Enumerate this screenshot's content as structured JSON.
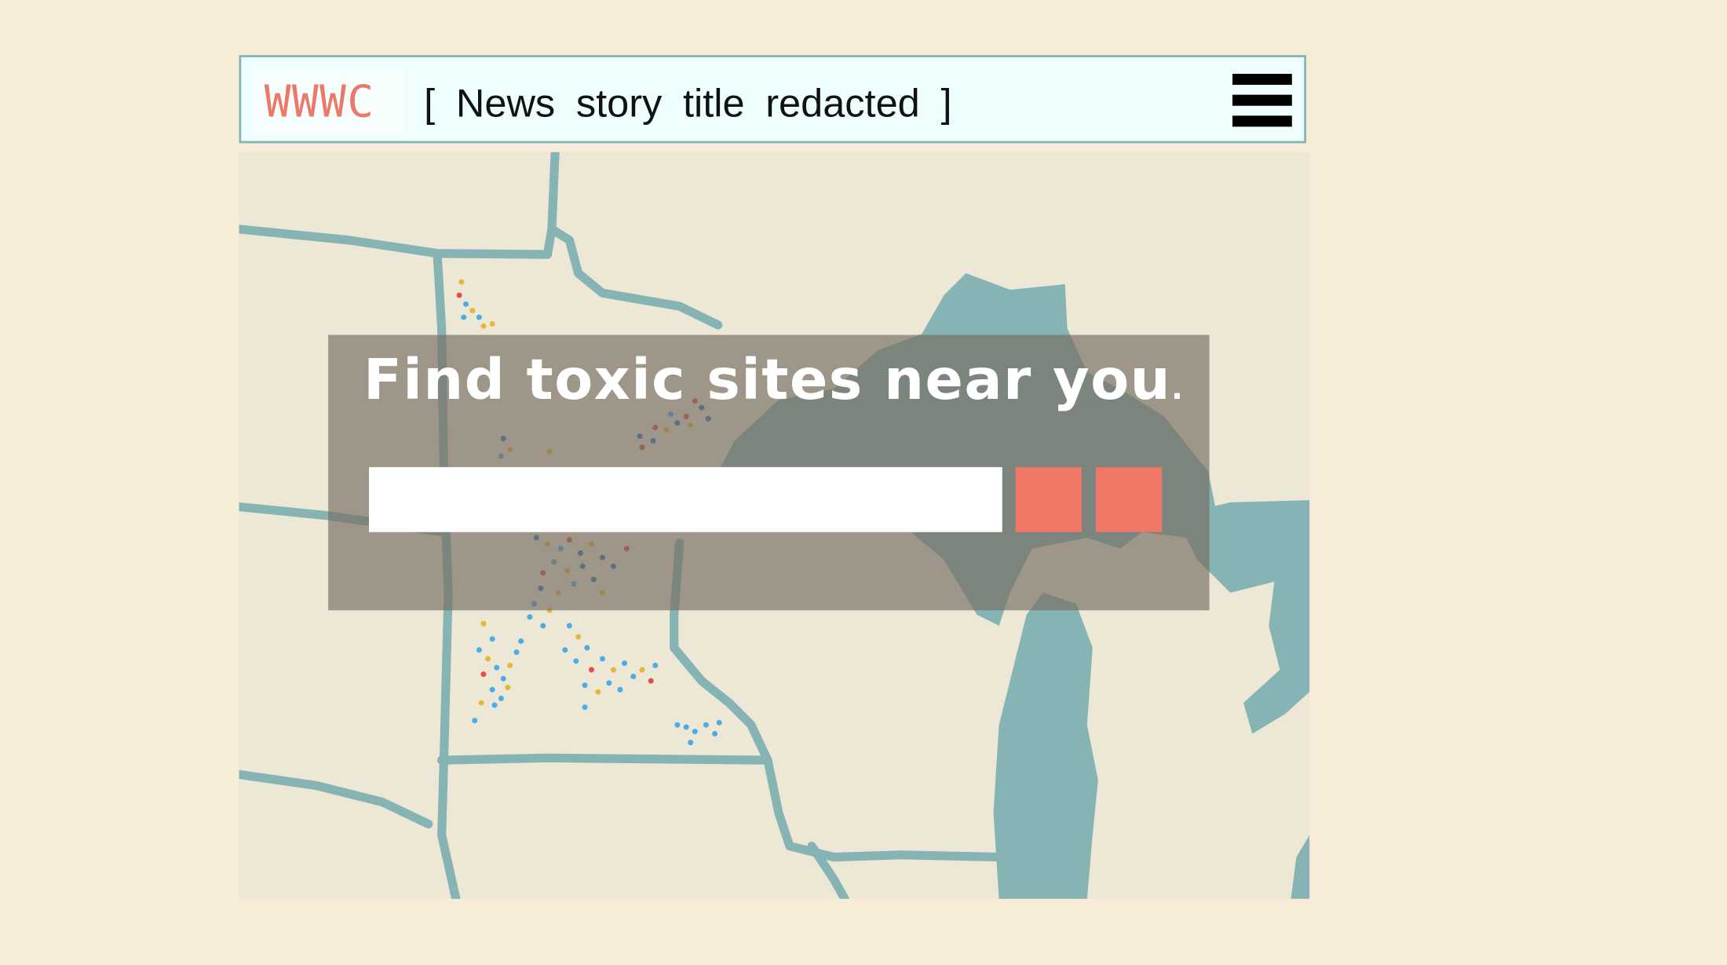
{
  "header": {
    "logo": "WWWC",
    "story_title": "[ News story title redacted ]"
  },
  "hero": {
    "headline": "Find toxic sites near you",
    "headline_punct": ".",
    "search_placeholder": "",
    "search_value": ""
  },
  "icons": {
    "menu": "hamburger-menu-icon"
  },
  "colors": {
    "page_background": "#f6ecd7",
    "header_background": "#eefefe",
    "logo_red": "#ec7868",
    "map_land": "#ede8d6",
    "map_water": "#86b4b4",
    "overlay": "#766c62",
    "button": "#f07867",
    "site_blue": "#4aaee6",
    "site_yellow": "#e2b93c",
    "site_red": "#e2504b",
    "site_darkblue": "#2f78b4"
  }
}
